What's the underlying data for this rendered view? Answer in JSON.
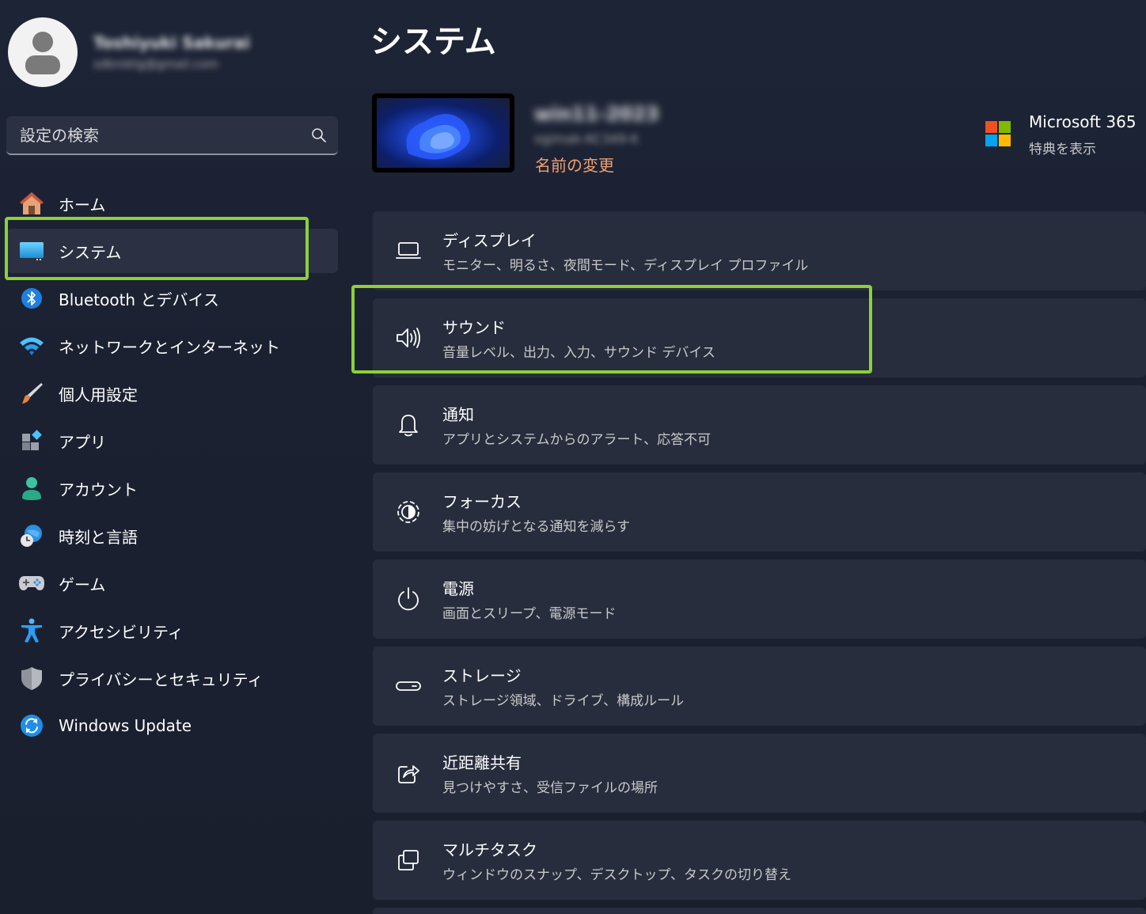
{
  "profile": {
    "name": "Toshiyuki Sakurai",
    "email": "sdkmktg@gmail.com"
  },
  "search": {
    "placeholder": "設定の検索"
  },
  "sidebar": {
    "items": [
      {
        "label": "ホーム",
        "icon": "home-icon"
      },
      {
        "label": "システム",
        "icon": "system-icon",
        "selected": true
      },
      {
        "label": "Bluetooth とデバイス",
        "icon": "bluetooth-icon"
      },
      {
        "label": "ネットワークとインターネット",
        "icon": "wifi-icon"
      },
      {
        "label": "個人用設定",
        "icon": "brush-icon"
      },
      {
        "label": "アプリ",
        "icon": "apps-icon"
      },
      {
        "label": "アカウント",
        "icon": "account-icon"
      },
      {
        "label": "時刻と言語",
        "icon": "globe-clock-icon"
      },
      {
        "label": "ゲーム",
        "icon": "gamepad-icon"
      },
      {
        "label": "アクセシビリティ",
        "icon": "accessibility-icon"
      },
      {
        "label": "プライバシーとセキュリティ",
        "icon": "shield-icon"
      },
      {
        "label": "Windows Update",
        "icon": "update-icon"
      }
    ]
  },
  "main": {
    "title": "システム",
    "device": {
      "name": "win11-2023",
      "model": "ogimak-KC349-K",
      "rename": "名前の変更"
    },
    "ms365": {
      "title": "Microsoft 365",
      "subtitle": "特典を表示"
    },
    "cards": [
      {
        "title": "ディスプレイ",
        "desc": "モニター、明るさ、夜間モード、ディスプレイ プロファイル",
        "icon": "laptop-icon"
      },
      {
        "title": "サウンド",
        "desc": "音量レベル、出力、入力、サウンド デバイス",
        "icon": "speaker-icon"
      },
      {
        "title": "通知",
        "desc": "アプリとシステムからのアラート、応答不可",
        "icon": "bell-icon"
      },
      {
        "title": "フォーカス",
        "desc": "集中の妨げとなる通知を減らす",
        "icon": "focus-icon"
      },
      {
        "title": "電源",
        "desc": "画面とスリープ、電源モード",
        "icon": "power-icon"
      },
      {
        "title": "ストレージ",
        "desc": "ストレージ領域、ドライブ、構成ルール",
        "icon": "storage-icon"
      },
      {
        "title": "近距離共有",
        "desc": "見つけやすさ、受信ファイルの場所",
        "icon": "share-icon"
      },
      {
        "title": "マルチタスク",
        "desc": "ウィンドウのスナップ、デスクトップ、タスクの切り替え",
        "icon": "multitask-icon"
      }
    ]
  },
  "colors": {
    "accent_highlight": "#8cd138",
    "rename_link": "#f0a071",
    "background": "#1c2233",
    "card": "#272d3d"
  }
}
